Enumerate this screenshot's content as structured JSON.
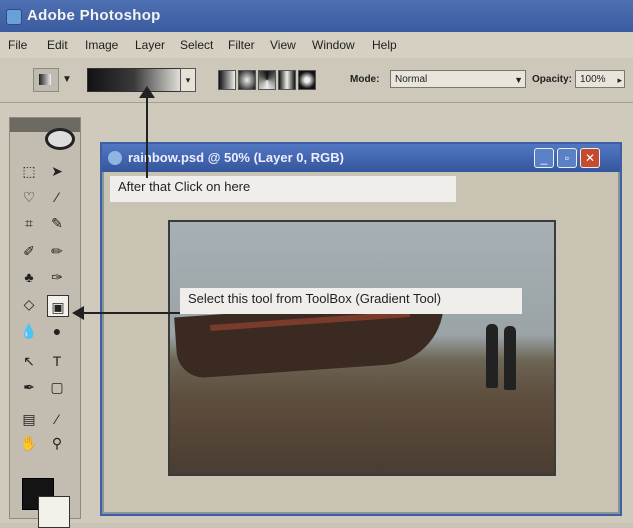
{
  "app": {
    "title": "Adobe Photoshop"
  },
  "menu": [
    "File",
    "Edit",
    "Image",
    "Layer",
    "Select",
    "Filter",
    "View",
    "Window",
    "Help"
  ],
  "options_bar": {
    "mode_label": "Mode:",
    "mode_value": "Normal",
    "opacity_label": "Opacity:",
    "opacity_value": "100%"
  },
  "document": {
    "title": "rainbow.psd @ 50% (Layer 0, RGB)"
  },
  "annotations": {
    "top": "After that Click on here",
    "tool": "Select this tool from ToolBox (Gradient Tool)"
  }
}
